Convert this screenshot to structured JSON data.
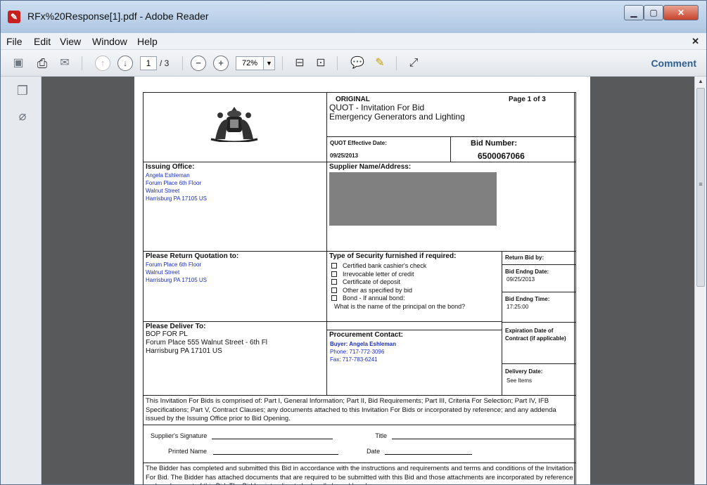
{
  "window": {
    "title": "RFx%20Response[1].pdf - Adobe Reader",
    "app_icon": "adobe-reader-icon"
  },
  "menu": [
    "File",
    "Edit",
    "View",
    "Window",
    "Help"
  ],
  "toolbar": {
    "page_current": "1",
    "page_total": "/ 3",
    "zoom": "72%",
    "comment": "Comment"
  },
  "document": {
    "header": {
      "status": "ORIGINAL",
      "page": "Page 1 of 3",
      "title_line1": "QUOT -  Invitation For Bid",
      "title_line2": "Emergency Generators and Lighting",
      "effective_label": "QUOT Effective Date:",
      "effective_date": "09/25/2013",
      "bid_number_label": "Bid  Number:",
      "bid_number": "6500067066"
    },
    "issuing_office": {
      "label": "Issuing Office:",
      "lines": [
        "Angela Eshleman",
        "Forum Place 6th Floor",
        "Walnut Street",
        "Harrisburg   PA    17105  US"
      ]
    },
    "supplier": {
      "label": "Supplier Name/Address:"
    },
    "return_to": {
      "label": "Please Return Quotation to:",
      "lines": [
        "Forum Place 6th Floor",
        "Walnut Street",
        "Harrisburg   PA    17105  US"
      ]
    },
    "security": {
      "label": "Type of Security furnished if required:",
      "options": [
        "Certified bank cashier's check",
        "Irrevocable letter of credit",
        "Certificate of deposit",
        "Other as specified by bid",
        "Bond - If annual bond:"
      ],
      "principal_question": "What is the name of the principal on the bond?"
    },
    "return_bid": {
      "label": "Return Bid by:",
      "end_date_label": "Bid Endng Date:",
      "end_date": "09/25/2013",
      "end_time_label": "Bid Endng Time:",
      "end_time": "17:25:00",
      "expiration_label": "Expiration Date of Contract (if applicable)",
      "delivery_label": "Delivery Date:",
      "delivery_value": "See Items"
    },
    "deliver_to": {
      "label": "Please Deliver To:",
      "lines": [
        "BOP FOR PL",
        "Forum Place 555 Walnut Street  - 6th Fl",
        "Harrisburg PA  17101  US"
      ]
    },
    "procurement": {
      "label": "Procurement Contact:",
      "buyer": "Buyer: Angela Eshleman",
      "phone": "Phone: 717-772-3096",
      "fax": "Fax: 717-783-6241"
    },
    "composition_text": "This Invitation For Bids is comprised of: Part I, General Information; Part II, Bid Requirements; Part III, Criteria For Selection; Part IV, IFB Specifications; Part V, Contract Clauses; any documents attached to this Invitation For Bids or incorporated by reference; and any addenda issued by the Issuing Office prior to Bid Opening.",
    "signature": {
      "signature_label": "Supplier's Signature",
      "title_label": "Title",
      "printed_label": "Printed Name",
      "date_label": "Date"
    },
    "bidder_text": "The Bidder has completed and submitted this Bid in accordance with the instructions and requirements and terms and conditions of the Invitation For Bid. The Bidder has attached documents that are required to be submitted with this Bid and those attachments are incorporated by reference and made a part of this Bid. The Bidder, intending to be legally bound hereby,"
  }
}
